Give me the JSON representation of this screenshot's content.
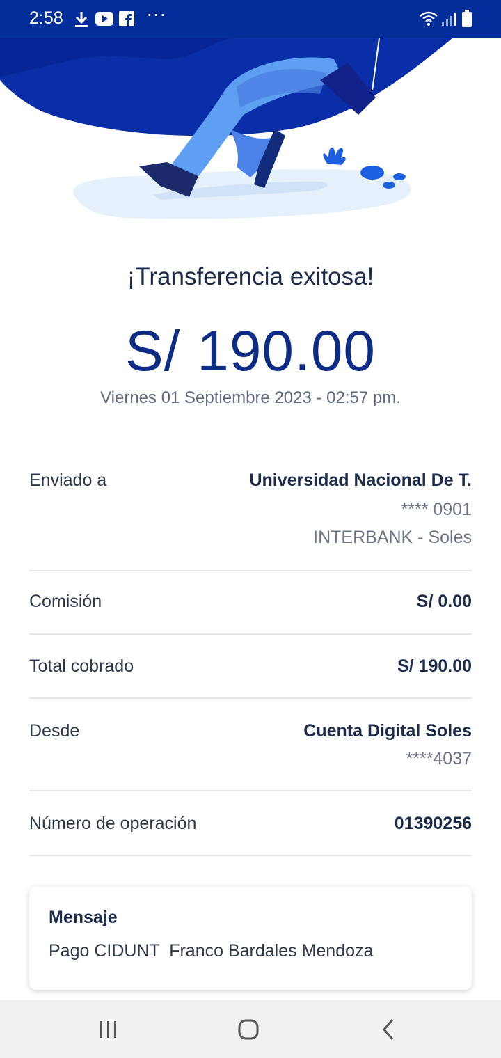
{
  "status_bar": {
    "time": "2:58",
    "icons_left": [
      "download-icon",
      "youtube-icon",
      "facebook-icon",
      "more-dots-icon"
    ],
    "icons_right": [
      "wifi-icon",
      "signal-icon",
      "battery-icon"
    ],
    "more": "···"
  },
  "transfer": {
    "title": "¡Transferencia exitosa!",
    "amount": "S/ 190.00",
    "datetime": "Viernes 01 Septiembre 2023 - 02:57 pm."
  },
  "details": {
    "sent_to": {
      "label": "Enviado a",
      "value": "Universidad Nacional De T.",
      "account": "**** 0901",
      "bank": "INTERBANK - Soles"
    },
    "commission": {
      "label": "Comisión",
      "value": "S/ 0.00"
    },
    "total": {
      "label": "Total cobrado",
      "value": "S/ 190.00"
    },
    "from": {
      "label": "Desde",
      "value": "Cuenta Digital Soles",
      "account": "****4037"
    },
    "operation": {
      "label": "Número de operación",
      "value": "01390256"
    }
  },
  "message": {
    "title": "Mensaje",
    "text": "Pago CIDUNT  Franco Bardales Mendoza"
  },
  "nav": [
    "recents-icon",
    "home-icon",
    "back-icon"
  ],
  "colors": {
    "status_bar": "#032e9a",
    "amount": "#0c2c86",
    "title": "#1d2b4a",
    "illustration_dark": "#0a2ea8",
    "illustration_light": "#5ea0f5"
  }
}
